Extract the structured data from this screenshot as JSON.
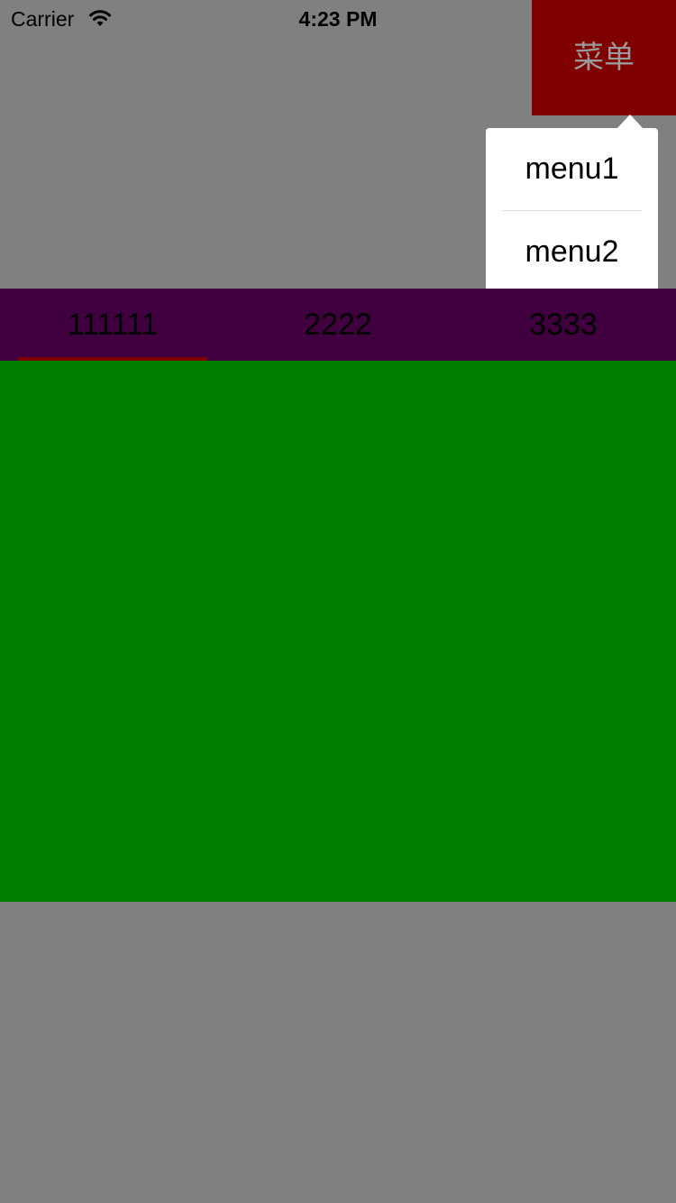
{
  "status_bar": {
    "carrier": "Carrier",
    "time": "4:23 PM",
    "icons": [
      "wifi-icon",
      "battery-icon"
    ]
  },
  "menu_button": {
    "label": "菜单",
    "background": "#800000",
    "text_color": "#9a9a9a"
  },
  "popover_menu": {
    "items": [
      {
        "label": "menu1"
      },
      {
        "label": "menu2"
      }
    ]
  },
  "tabs": {
    "items": [
      {
        "label": "111111",
        "selected": true
      },
      {
        "label": "2222",
        "selected": false
      },
      {
        "label": "3333",
        "selected": false
      }
    ],
    "background": "#400040",
    "indicator_color": "#800000"
  },
  "content_panel": {
    "background": "#008000"
  },
  "page": {
    "background": "#808080"
  }
}
